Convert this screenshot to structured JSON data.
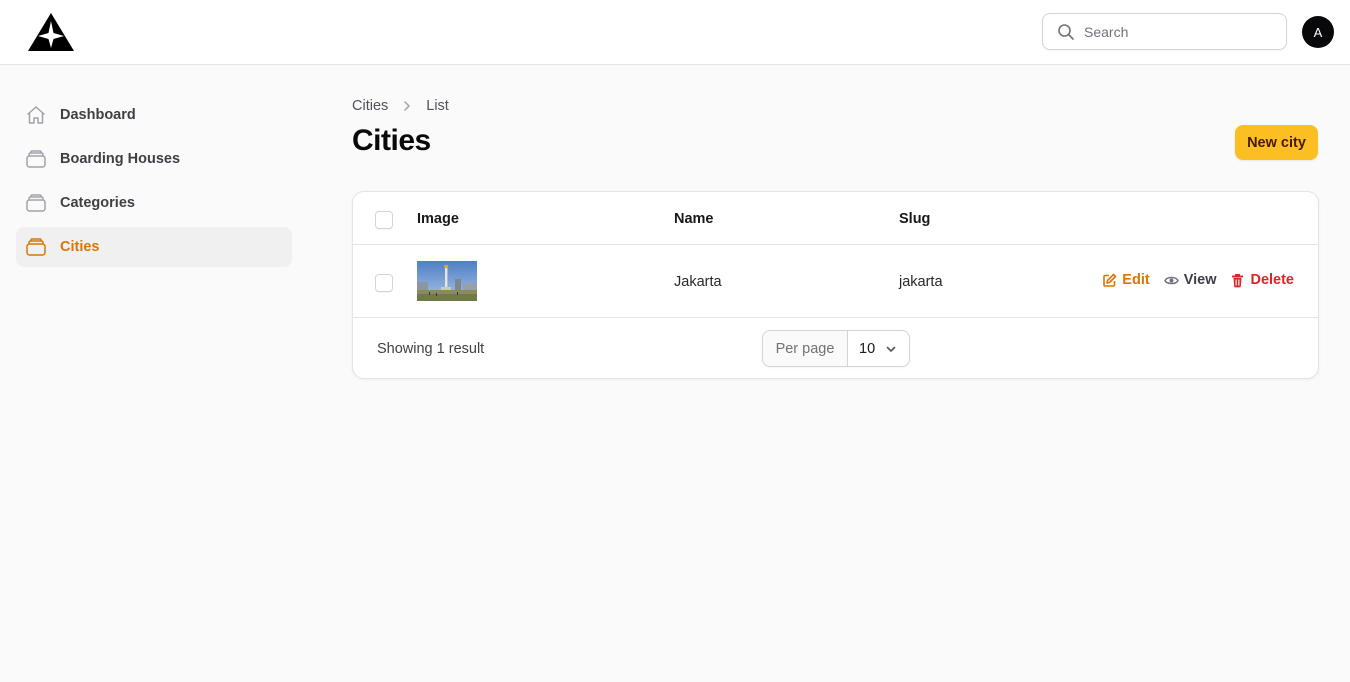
{
  "app": {
    "logo_icon": "aeropanel-logo"
  },
  "header": {
    "search_placeholder": "Search",
    "avatar_initial": "A"
  },
  "sidebar": {
    "items": [
      {
        "label": "Dashboard",
        "icon": "home-icon",
        "active": false
      },
      {
        "label": "Boarding Houses",
        "icon": "stack-icon",
        "active": false
      },
      {
        "label": "Categories",
        "icon": "stack-icon",
        "active": false
      },
      {
        "label": "Cities",
        "icon": "stack-icon",
        "active": true
      }
    ]
  },
  "breadcrumb": {
    "parent": "Cities",
    "current": "List"
  },
  "page": {
    "title": "Cities",
    "new_button": "New city"
  },
  "table": {
    "columns": [
      "Image",
      "Name",
      "Slug"
    ],
    "rows": [
      {
        "image": "jakarta-monument-thumbnail",
        "name": "Jakarta",
        "slug": "jakarta"
      }
    ],
    "actions": {
      "edit": "Edit",
      "view": "View",
      "delete": "Delete"
    },
    "footer": {
      "result_text": "Showing 1 result",
      "per_page_label": "Per page",
      "per_page_value": "10"
    }
  },
  "colors": {
    "accent": "#d97706",
    "button": "#fbbf24",
    "danger": "#dc2626"
  }
}
